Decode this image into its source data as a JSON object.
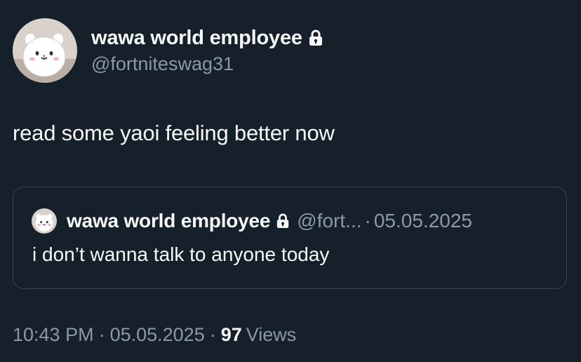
{
  "tweet": {
    "author": {
      "display_name": "wawa world employee",
      "handle": "@fortniteswag31",
      "avatar_icon": "cartoon-hamster-avatar",
      "protected_icon": "lock-icon"
    },
    "text": "read some yaoi feeling better now",
    "quoted": {
      "display_name": "wawa world employee",
      "handle": "@fort...",
      "separator": "·",
      "date": "05.05.2025",
      "text": "i don’t wanna talk to anyone today"
    },
    "meta": {
      "time": "10:43 PM",
      "separator": "·",
      "date": "05.05.2025",
      "views_count": "97",
      "views_label": "Views"
    }
  },
  "colors": {
    "background": "#15202b",
    "primary_text": "#f7f9f9",
    "secondary_text": "#8b98a5",
    "border": "#38444d"
  }
}
